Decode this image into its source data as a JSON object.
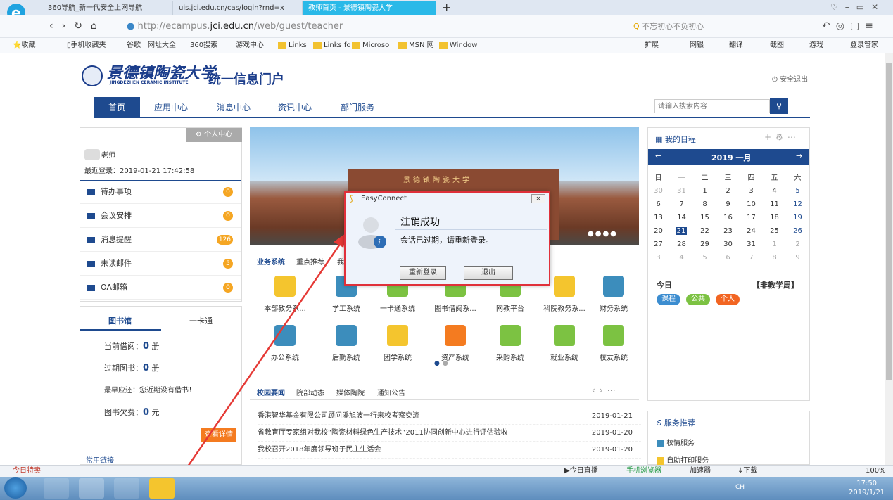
{
  "browser": {
    "tabs": [
      {
        "label": "360导航_新一代安全上网导航"
      },
      {
        "label": "uis.jci.edu.cn/cas/login?rnd=x"
      },
      {
        "label": "教师首页 - 景德镇陶瓷大学"
      }
    ],
    "new_tab": "+",
    "url_prefix": "http://ecampus.",
    "url_domain": "jci.edu.cn",
    "url_path": "/web/guest/teacher",
    "search_hint": "不忘初心不负初心",
    "favorites": [
      "收藏",
      "手机收藏夹",
      "谷歌",
      "网址大全",
      "360搜索",
      "游戏中心",
      "Links",
      "Links fo",
      "Microso",
      "MSN 网",
      "Window"
    ],
    "right_tools": [
      "扩展",
      "网银",
      "翻译",
      "截图",
      "游戏",
      "登录管家"
    ]
  },
  "header": {
    "school_cn": "景德镇陶瓷大学",
    "school_en": "JINGDEZHEN CERAMIC INSTITUTE",
    "portal": "统一信息门户",
    "logout": "安全退出"
  },
  "nav": {
    "items": [
      "首页",
      "应用中心",
      "消息中心",
      "资讯中心",
      "部门服务"
    ],
    "search_placeholder": "请输入搜索内容"
  },
  "profile": {
    "center": "个人中心",
    "name": "老师",
    "last_login": "最近登录：2019-01-21 17:42:58"
  },
  "left_items": [
    {
      "label": "待办事项",
      "count": "0"
    },
    {
      "label": "会议安排",
      "count": "0"
    },
    {
      "label": "消息提醒",
      "count": "126"
    },
    {
      "label": "未读邮件",
      "count": "5"
    },
    {
      "label": "OA邮箱",
      "count": "0"
    }
  ],
  "library": {
    "tab1": "图书馆",
    "tab2": "一卡通",
    "rows": [
      {
        "label": "当前借阅：",
        "value": "0",
        "unit": "册"
      },
      {
        "label": "过期图书：",
        "value": "0",
        "unit": "册"
      },
      {
        "label": "最早应还：您近期没有借书！",
        "value": "",
        "unit": ""
      },
      {
        "label": "图书欠费：",
        "value": "0",
        "unit": "元"
      }
    ],
    "detail_btn": "查看详情",
    "more": "常用链接"
  },
  "banner": {
    "caption": "景德镇陶瓷大学"
  },
  "systems": {
    "tabs": [
      "业务系统",
      "重点推荐",
      "我"
    ],
    "items": [
      {
        "label": "本部教务系...",
        "color": "#f4c52e"
      },
      {
        "label": "学工系统",
        "color": "#3c8dbc"
      },
      {
        "label": "一卡通系统",
        "color": "#7cc242"
      },
      {
        "label": "图书借阅系...",
        "color": "#7cc242"
      },
      {
        "label": "网教平台",
        "color": "#7cc242"
      },
      {
        "label": "科院教务系...",
        "color": "#f4c52e"
      },
      {
        "label": "财务系统",
        "color": "#3c8dbc"
      },
      {
        "label": "办公系统",
        "color": "#3c8dbc"
      },
      {
        "label": "后勤系统",
        "color": "#3c8dbc"
      },
      {
        "label": "团学系统",
        "color": "#f4c52e"
      },
      {
        "label": "资产系统",
        "color": "#f47b20"
      },
      {
        "label": "采购系统",
        "color": "#7cc242"
      },
      {
        "label": "就业系统",
        "color": "#7cc242"
      },
      {
        "label": "校友系统",
        "color": "#7cc242"
      }
    ]
  },
  "news": {
    "tabs": [
      "校园要闻",
      "院部动态",
      "媒体陶院",
      "通知公告"
    ],
    "rows": [
      {
        "title": "香港智华基金有限公司顾问潘旭波一行来校考察交流",
        "date": "2019-01-21"
      },
      {
        "title": "省教育厅专家组对我校“陶瓷材料绿色生产技术”2011协同创新中心进行评估验收",
        "date": "2019-01-20"
      },
      {
        "title": "我校召开2018年度领导班子民主生活会",
        "date": "2019-01-20"
      }
    ]
  },
  "calendar": {
    "title": "我的日程",
    "month": "2019 一月",
    "weekdays": [
      "日",
      "一",
      "二",
      "三",
      "四",
      "五",
      "六"
    ],
    "days": [
      "30",
      "31",
      "1",
      "2",
      "3",
      "4",
      "5",
      "6",
      "7",
      "8",
      "9",
      "10",
      "11",
      "12",
      "13",
      "14",
      "15",
      "16",
      "17",
      "18",
      "19",
      "20",
      "21",
      "22",
      "23",
      "24",
      "25",
      "26",
      "27",
      "28",
      "29",
      "30",
      "31",
      "1",
      "2",
      "3",
      "4",
      "5",
      "6",
      "7",
      "8",
      "9"
    ],
    "today_label": "今日",
    "week_label": "【非教学周】",
    "tags": [
      "课程",
      "公共",
      "个人"
    ]
  },
  "services": {
    "title": "服务推荐",
    "items": [
      "校情服务",
      "自助打印服务"
    ]
  },
  "dialog": {
    "app": "EasyConnect",
    "title": "注销成功",
    "message": "会话已过期，请重新登录。",
    "relogin": "重新登录",
    "exit": "退出"
  },
  "status": {
    "left": "今日特卖",
    "live": "今日直播",
    "mobile": "手机浏览器",
    "accel": "加速器",
    "download": "下载",
    "zoom": "100%"
  },
  "tray": {
    "ime": "CH",
    "time": "17:50",
    "date": "2019/1/21"
  }
}
